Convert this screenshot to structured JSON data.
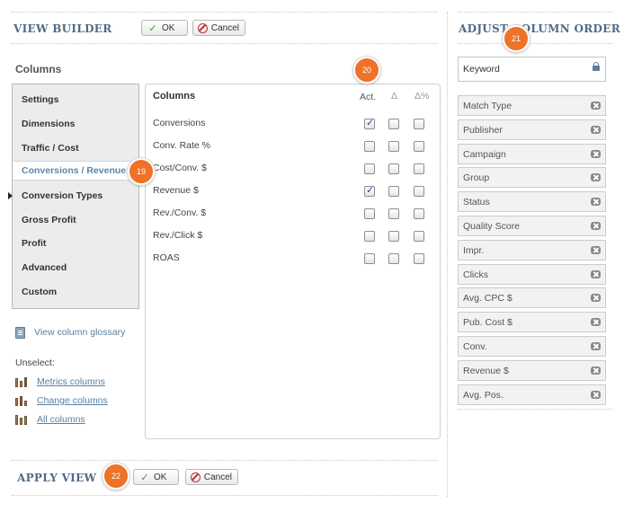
{
  "view_builder": {
    "title": "VIEW BUILDER",
    "ok_label": "OK",
    "cancel_label": "Cancel"
  },
  "adjust_order": {
    "title": "ADJUST COLUMN ORDER",
    "locked_field": "Keyword",
    "fields": [
      "Match Type",
      "Publisher",
      "Campaign",
      "Group",
      "Status",
      "Quality Score",
      "Impr.",
      "Clicks",
      "Avg. CPC $",
      "Pub. Cost $",
      "Conv.",
      "Revenue $",
      "Avg. Pos."
    ]
  },
  "columns_section": {
    "heading": "Columns",
    "nav": [
      "Settings",
      "Dimensions",
      "Traffic / Cost",
      "Conversions / Revenue",
      "Conversion Types",
      "Gross Profit",
      "Profit",
      "Advanced",
      "Custom"
    ],
    "active_nav": "Conversions / Revenue"
  },
  "panel": {
    "title": "Columns",
    "col_act": "Act.",
    "col_delta": "Δ",
    "col_delta_pct": "Δ%",
    "rows": [
      {
        "label": "Conversions",
        "act": true,
        "delta": false,
        "delta_pct": false
      },
      {
        "label": "Conv. Rate %",
        "act": false,
        "delta": false,
        "delta_pct": false
      },
      {
        "label": "Cost/Conv. $",
        "act": false,
        "delta": false,
        "delta_pct": false
      },
      {
        "label": "Revenue $",
        "act": true,
        "delta": false,
        "delta_pct": false
      },
      {
        "label": "Rev./Conv. $",
        "act": false,
        "delta": false,
        "delta_pct": false
      },
      {
        "label": "Rev./Click $",
        "act": false,
        "delta": false,
        "delta_pct": false
      },
      {
        "label": "ROAS",
        "act": false,
        "delta": false,
        "delta_pct": false
      }
    ]
  },
  "glossary_link": "View column glossary",
  "unselect": {
    "label": "Unselect:",
    "links": [
      "Metrics columns",
      "Change columns",
      "All columns"
    ]
  },
  "apply_view": {
    "title": "APPLY VIEW",
    "ok_label": "OK",
    "cancel_label": "Cancel"
  },
  "badges": [
    "19",
    "20",
    "21",
    "22"
  ],
  "colors": {
    "accent": "#4f6b86",
    "badge": "#ee7227",
    "link": "#5a7fa0"
  }
}
